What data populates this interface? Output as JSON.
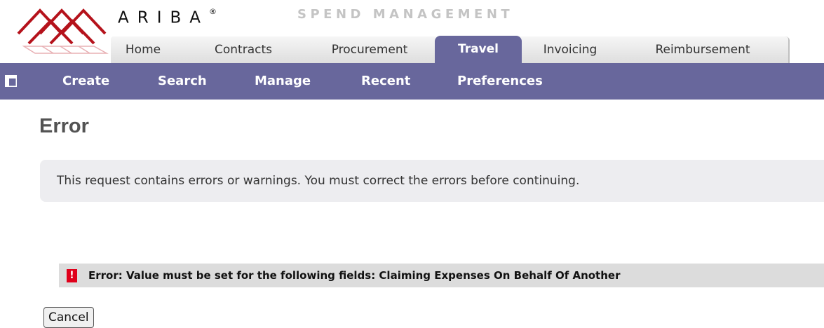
{
  "header": {
    "brand": "ARIBA",
    "brand_mark": "®",
    "tagline": "SPEND MANAGEMENT"
  },
  "tabs": [
    {
      "label": "Home",
      "active": false
    },
    {
      "label": "Contracts",
      "active": false
    },
    {
      "label": "Procurement",
      "active": false
    },
    {
      "label": "Travel",
      "active": true
    },
    {
      "label": "Invoicing",
      "active": false
    },
    {
      "label": "Reimbursement",
      "active": false
    }
  ],
  "menu": {
    "icon": "layout-icon",
    "items": [
      {
        "label": "Create"
      },
      {
        "label": "Search"
      },
      {
        "label": "Manage"
      },
      {
        "label": "Recent"
      },
      {
        "label": "Preferences"
      }
    ]
  },
  "page": {
    "title": "Error",
    "message": "This request contains errors or warnings. You must correct the errors before continuing.",
    "error_icon_label": "!",
    "error_text": "Error: Value must be set for the following fields: Claiming Expenses On Behalf Of Another",
    "cancel_label": "Cancel"
  },
  "colors": {
    "nav_bar": "#68679c",
    "logo_red": "#b5121b",
    "error_icon": "#e0001b",
    "message_panel": "#ededf0",
    "error_banner": "#dcdcdc"
  }
}
